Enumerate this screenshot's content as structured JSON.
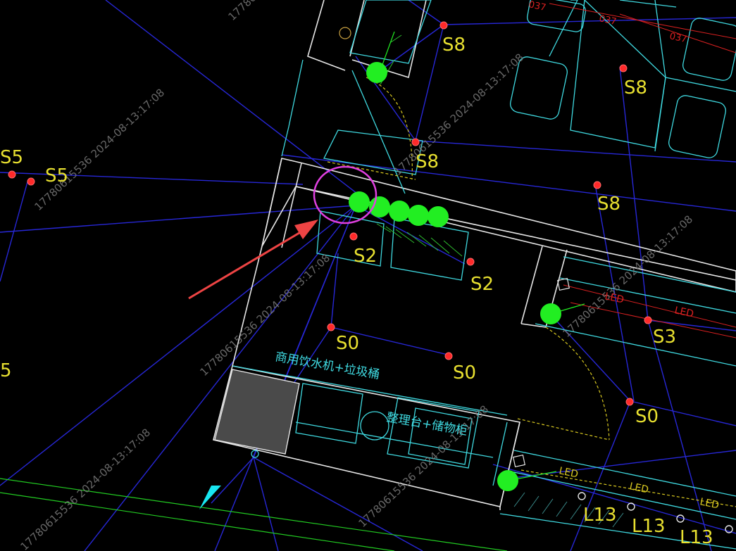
{
  "watermark": "17780615536 2024-08-13:17:08",
  "labels": {
    "s5_left_top": "S5",
    "s5_mid": "S5",
    "s5_left_bottom": "5",
    "s8_top": "S8",
    "s8_right_top": "S8",
    "s8_mid": "S8",
    "s8_right_mid": "S8",
    "s2_left": "S2",
    "s2_right": "S2",
    "s0_a": "S0",
    "s0_b": "S0",
    "s0_c": "S0",
    "s3": "S3",
    "led_1": "LED",
    "led_2": "LED",
    "led_3": "LED",
    "led_4": "LED",
    "led_5": "LED",
    "l13_a": "L13",
    "l13_b": "L13",
    "l13_c": "L13",
    "dim_1": "037",
    "dim_2": "037",
    "dim_3": "037",
    "water_machine": "商用饮水机+垃圾桶",
    "prep_counter": "整理台+储物柜"
  },
  "colors": {
    "background": "#000000",
    "wall": "#e6e6e6",
    "furniture": "#3fd9e0",
    "wiring": "#2727d6",
    "label": "#e8e030",
    "light_fixture": "#22ee22",
    "socket": "#ff2a2a",
    "highlight_circle": "#e040e0",
    "arrow": "#ee4444",
    "pointer": "#18e6f0"
  }
}
